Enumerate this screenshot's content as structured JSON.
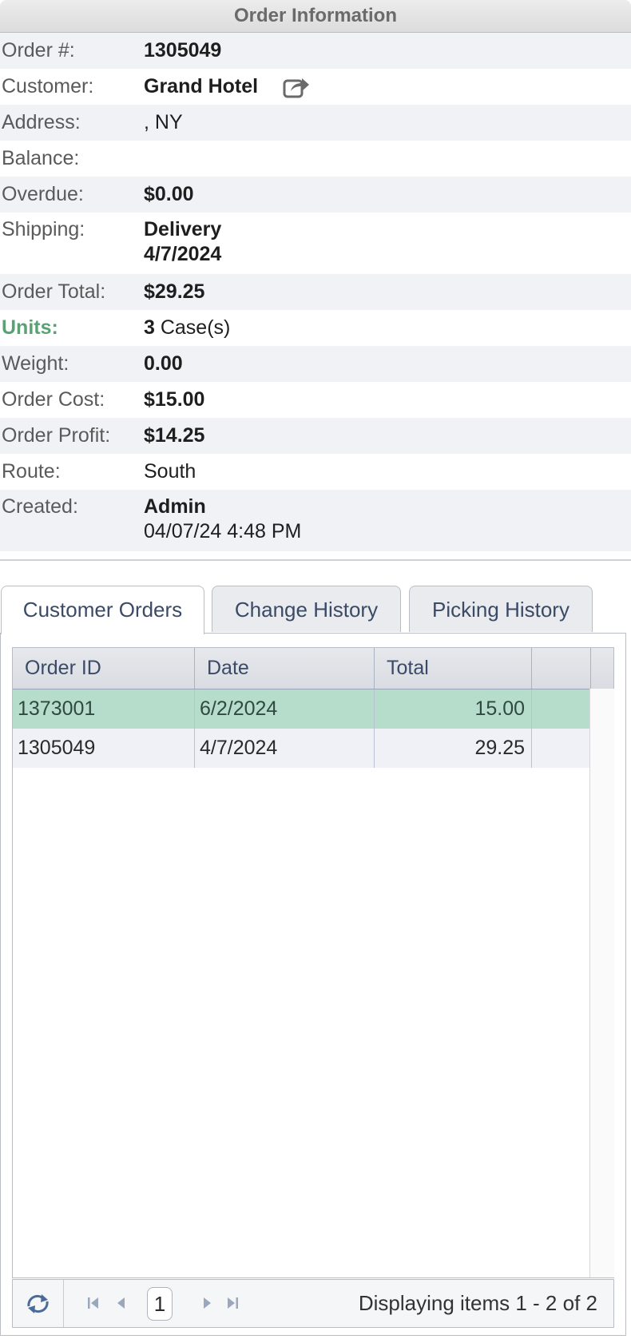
{
  "panel": {
    "title": "Order Information"
  },
  "info": {
    "order_label": "Order #:",
    "order_value": "1305049",
    "customer_label": "Customer:",
    "customer_value": "Grand Hotel",
    "address_label": "Address:",
    "address_value": ", NY",
    "balance_label": "Balance:",
    "balance_value": "",
    "overdue_label": "Overdue:",
    "overdue_value": "$0.00",
    "shipping_label": "Shipping:",
    "shipping_method": "Delivery",
    "shipping_date": "4/7/2024",
    "total_label": "Order Total:",
    "total_value": "$29.25",
    "units_label": "Units:",
    "units_count": "3",
    "units_unit": " Case(s)",
    "weight_label": "Weight:",
    "weight_value": "0.00",
    "cost_label": "Order Cost:",
    "cost_value": "$15.00",
    "profit_label": "Order Profit:",
    "profit_value": "$14.25",
    "route_label": "Route:",
    "route_value": "South",
    "created_label": "Created:",
    "created_by": "Admin",
    "created_at": "04/07/24 4:48 PM"
  },
  "tabs": [
    "Customer Orders",
    "Change History",
    "Picking History"
  ],
  "grid": {
    "columns": [
      "Order ID",
      "Date",
      "Total",
      ""
    ],
    "rows": [
      {
        "id": "1373001",
        "date": "6/2/2024",
        "total": "15.00",
        "selected": true
      },
      {
        "id": "1305049",
        "date": "4/7/2024",
        "total": "29.25",
        "selected": false
      }
    ]
  },
  "pager": {
    "page": "1",
    "status": "Displaying items 1 - 2 of 2"
  },
  "colors": {
    "selected_row": "#b6dccb",
    "accent_green": "#5aa276",
    "link_blue": "#3a78b8"
  },
  "icons": [
    "share-icon",
    "refresh-icon",
    "first-page-icon",
    "prev-page-icon",
    "next-page-icon",
    "last-page-icon"
  ]
}
